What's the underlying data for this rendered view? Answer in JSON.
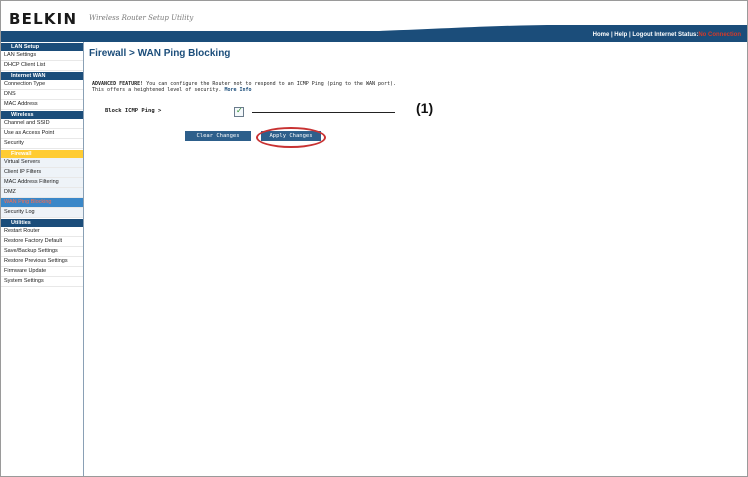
{
  "header": {
    "logo": "BELKIN",
    "tagline": "Wireless Router Setup Utility",
    "links": {
      "home": "Home",
      "sep1": " | ",
      "help": "Help",
      "sep2": " | ",
      "logout": "Logout",
      "status_label": "   Internet Status:",
      "status_value": "No Connection"
    }
  },
  "sidebar": {
    "sections": [
      {
        "title": "LAN Setup",
        "items": [
          "LAN Settings",
          "DHCP Client List"
        ]
      },
      {
        "title": "Internet WAN",
        "items": [
          "Connection Type",
          "DNS",
          "MAC Address"
        ]
      },
      {
        "title": "Wireless",
        "items": [
          "Channel and SSID",
          "Use as Access Point",
          "Security"
        ]
      },
      {
        "title": "Firewall",
        "items": [
          "Virtual Servers",
          "Client IP Filters",
          "MAC Address Filtering",
          "DMZ",
          "WAN Ping Blocking",
          "Security Log"
        ]
      },
      {
        "title": "Utilities",
        "items": [
          "Restart Router",
          "Restore Factory Default",
          "Save/Backup Settings",
          "Restore Previous Settings",
          "Firmware Update",
          "System Settings"
        ]
      }
    ]
  },
  "main": {
    "title": "Firewall > WAN Ping Blocking",
    "desc_bold": "ADVANCED FEATURE!",
    "desc_line1": " You can configure the Router not to respond to an ICMP Ping (ping to the WAN port).",
    "desc_line2": "This offers a heightened level of security. ",
    "more_info": "More Info",
    "block_label": "Block ICMP Ping >",
    "block_checked": true,
    "callout": "(1)",
    "clear_button": "Clear Changes",
    "apply_button": "Apply Changes"
  },
  "colors": {
    "navy": "#1b4d7a",
    "firewall_active": "#ffcc33",
    "selected_item": "#3a87c8",
    "highlight_red": "#c83232"
  }
}
